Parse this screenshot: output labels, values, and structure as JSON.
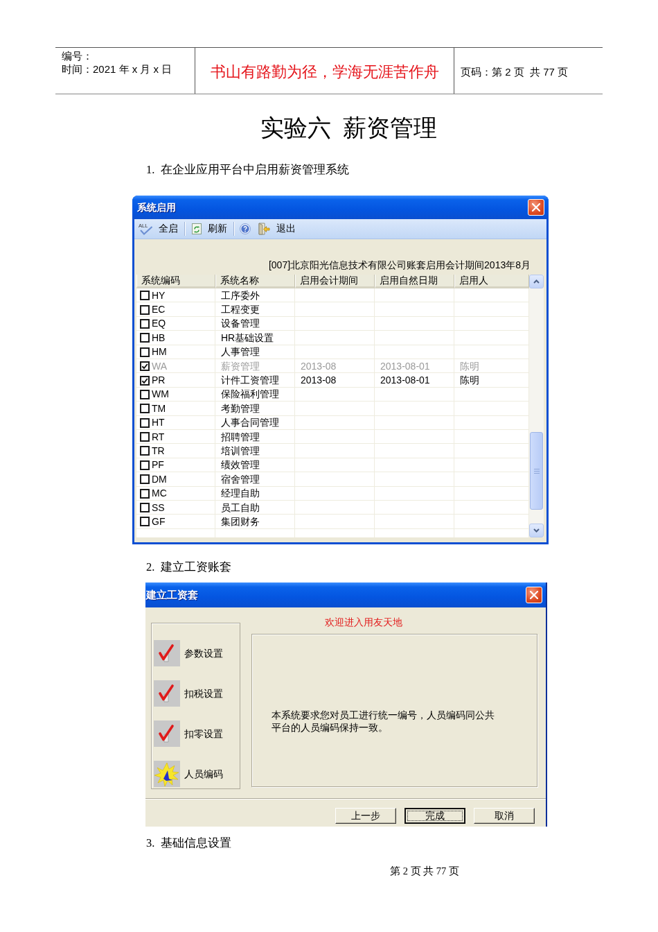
{
  "header": {
    "number_label": "编号：",
    "date": "时间：2021 年 x 月 x 日",
    "motto": "书山有路勤为径，学海无涯苦作舟",
    "page_info": "页码：第 2 页  共 77 页"
  },
  "title": "实验六  薪资管理",
  "step_1": "1.  在企业应用平台中启用薪资管理系统",
  "system_enable_window": {
    "title": "系统启用",
    "toolbar": [
      {
        "items": [
          {
            "kind": "all",
            "icon_text": "ALL",
            "label": "全启"
          }
        ]
      },
      {
        "items": [
          {
            "kind": "refresh",
            "label": "刷新"
          }
        ]
      },
      {
        "items": [
          {
            "kind": "help"
          },
          {
            "kind": "exit",
            "label": "退出"
          }
        ]
      }
    ],
    "info": "[007]北京阳光信息技术有限公司账套启用会计期间2013年8月",
    "table": {
      "columns": [
        "系统编码",
        "系统名称",
        "启用会计期间",
        "启用自然日期",
        "启用人"
      ],
      "rows": [
        {
          "code": "HY",
          "name": "工序委外",
          "checked": false,
          "disabled": false
        },
        {
          "code": "EC",
          "name": "工程变更",
          "checked": false,
          "disabled": false
        },
        {
          "code": "EQ",
          "name": "设备管理",
          "checked": false,
          "disabled": false
        },
        {
          "code": "HB",
          "name": "HR基础设置",
          "checked": false,
          "disabled": false
        },
        {
          "code": "HM",
          "name": "人事管理",
          "checked": false,
          "disabled": false
        },
        {
          "code": "WA",
          "name": "薪资管理",
          "period": "2013-08",
          "date": "2013-08-01",
          "user": "陈明",
          "checked": true,
          "disabled": true
        },
        {
          "code": "PR",
          "name": "计件工资管理",
          "period": "2013-08",
          "date": "2013-08-01",
          "user": "陈明",
          "checked": true,
          "disabled": false
        },
        {
          "code": "WM",
          "name": "保险福利管理",
          "checked": false,
          "disabled": false
        },
        {
          "code": "TM",
          "name": "考勤管理",
          "checked": false,
          "disabled": false
        },
        {
          "code": "HT",
          "name": "人事合同管理",
          "checked": false,
          "disabled": false
        },
        {
          "code": "RT",
          "name": "招聘管理",
          "checked": false,
          "disabled": false
        },
        {
          "code": "TR",
          "name": "培训管理",
          "checked": false,
          "disabled": false
        },
        {
          "code": "PF",
          "name": "绩效管理",
          "checked": false,
          "disabled": false
        },
        {
          "code": "DM",
          "name": "宿舍管理",
          "checked": false,
          "disabled": false
        },
        {
          "code": "MC",
          "name": "经理自助",
          "checked": false,
          "disabled": false
        },
        {
          "code": "SS",
          "name": "员工自助",
          "checked": false,
          "disabled": false
        },
        {
          "code": "GF",
          "name": "集团财务",
          "checked": false,
          "disabled": false
        }
      ]
    }
  },
  "step_2": "2.  建立工资账套",
  "wage_set_window": {
    "title": "建立工资套",
    "steps": [
      {
        "label": "参数设置",
        "kind": "done"
      },
      {
        "label": "扣税设置",
        "kind": "done"
      },
      {
        "label": "扣零设置",
        "kind": "done"
      },
      {
        "label": "人员编码",
        "kind": "current"
      }
    ],
    "welcome": "欢迎进入用友天地",
    "message": "本系统要求您对员工进行统一编号，人员编码同公共平台的人员编码保持一致。",
    "buttons": [
      {
        "label": "上一步",
        "focused": false
      },
      {
        "label": "完成",
        "focused": true
      },
      {
        "label": "取消",
        "focused": false
      }
    ]
  },
  "step_3": "3.  基础信息设置",
  "footer": "第 2 页 共 77 页"
}
